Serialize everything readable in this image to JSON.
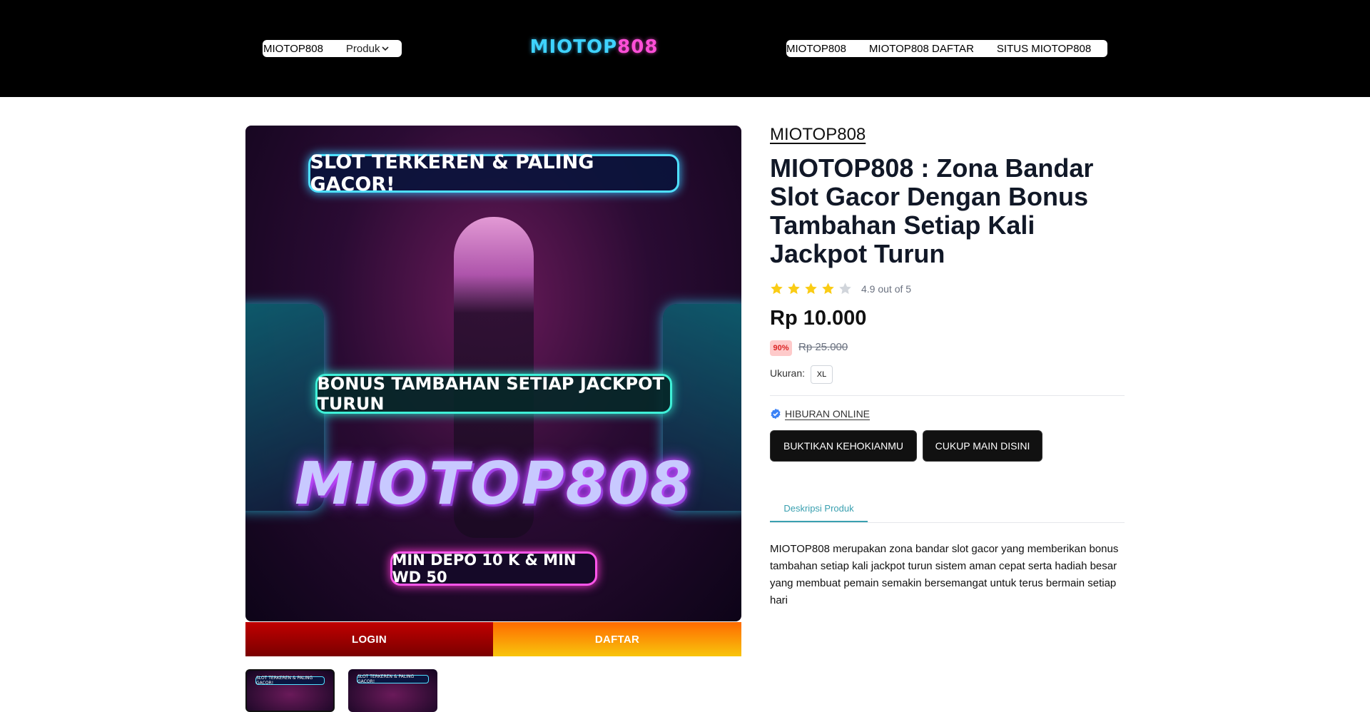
{
  "header": {
    "home_link": "MIOTOP808",
    "product_select": "Produk",
    "logo_part1": "MIOTOP",
    "logo_part2": "808",
    "links": [
      "MIOTOP808",
      "MIOTOP808 DAFTAR",
      "SITUS MIOTOP808"
    ]
  },
  "hero": {
    "banner_top": "SLOT TERKEREN & PALING GACOR!",
    "banner_middle": "BONUS TAMBAHAN SETIAP JACKPOT TURUN",
    "banner_brand": "MIOTOP808",
    "banner_bottom": "MIN DEPO 10 K & MIN WD 50"
  },
  "cta": {
    "login": "LOGIN",
    "daftar": "DAFTAR"
  },
  "thumbnails": [
    {
      "caption": "SLOT TERKEREN & PALING GACOR!"
    },
    {
      "caption": "SLOT TERKEREN & PALING GACOR!"
    }
  ],
  "product": {
    "brand": "MIOTOP808",
    "title": "MIOTOP808 : Zona Bandar Slot Gacor Dengan Bonus Tambahan Setiap Kali Jackpot Turun",
    "rating_value": 4.9,
    "rating_text": "4.9 out of 5",
    "stars_filled": 4,
    "stars_total": 5,
    "price": "Rp 10.000",
    "discount": "90%",
    "old_price": "Rp 25.000",
    "size_label": "Ukuran:",
    "size_value": "XL",
    "seller": "HIBURAN ONLINE",
    "button1": "BUKTIKAN KEHOKIANMU",
    "button2": "CUKUP MAIN DISINI",
    "tab": "Deskripsi Produk",
    "description": "MIOTOP808 merupakan zona bandar slot gacor yang memberikan bonus tambahan setiap kali jackpot turun sistem aman cepat serta hadiah besar yang membuat pemain semakin bersemangat untuk terus bermain setiap hari"
  },
  "colors": {
    "header_bg": "#000000",
    "star_filled": "#facc15",
    "star_empty": "#d1d5db",
    "login_red": "#c00000",
    "daftar_orange": "#ff6a00",
    "tab_accent": "#3aa0b0",
    "discount_bg": "#fecaca",
    "discount_text": "#dc2626",
    "verified_blue": "#3b82f6"
  }
}
